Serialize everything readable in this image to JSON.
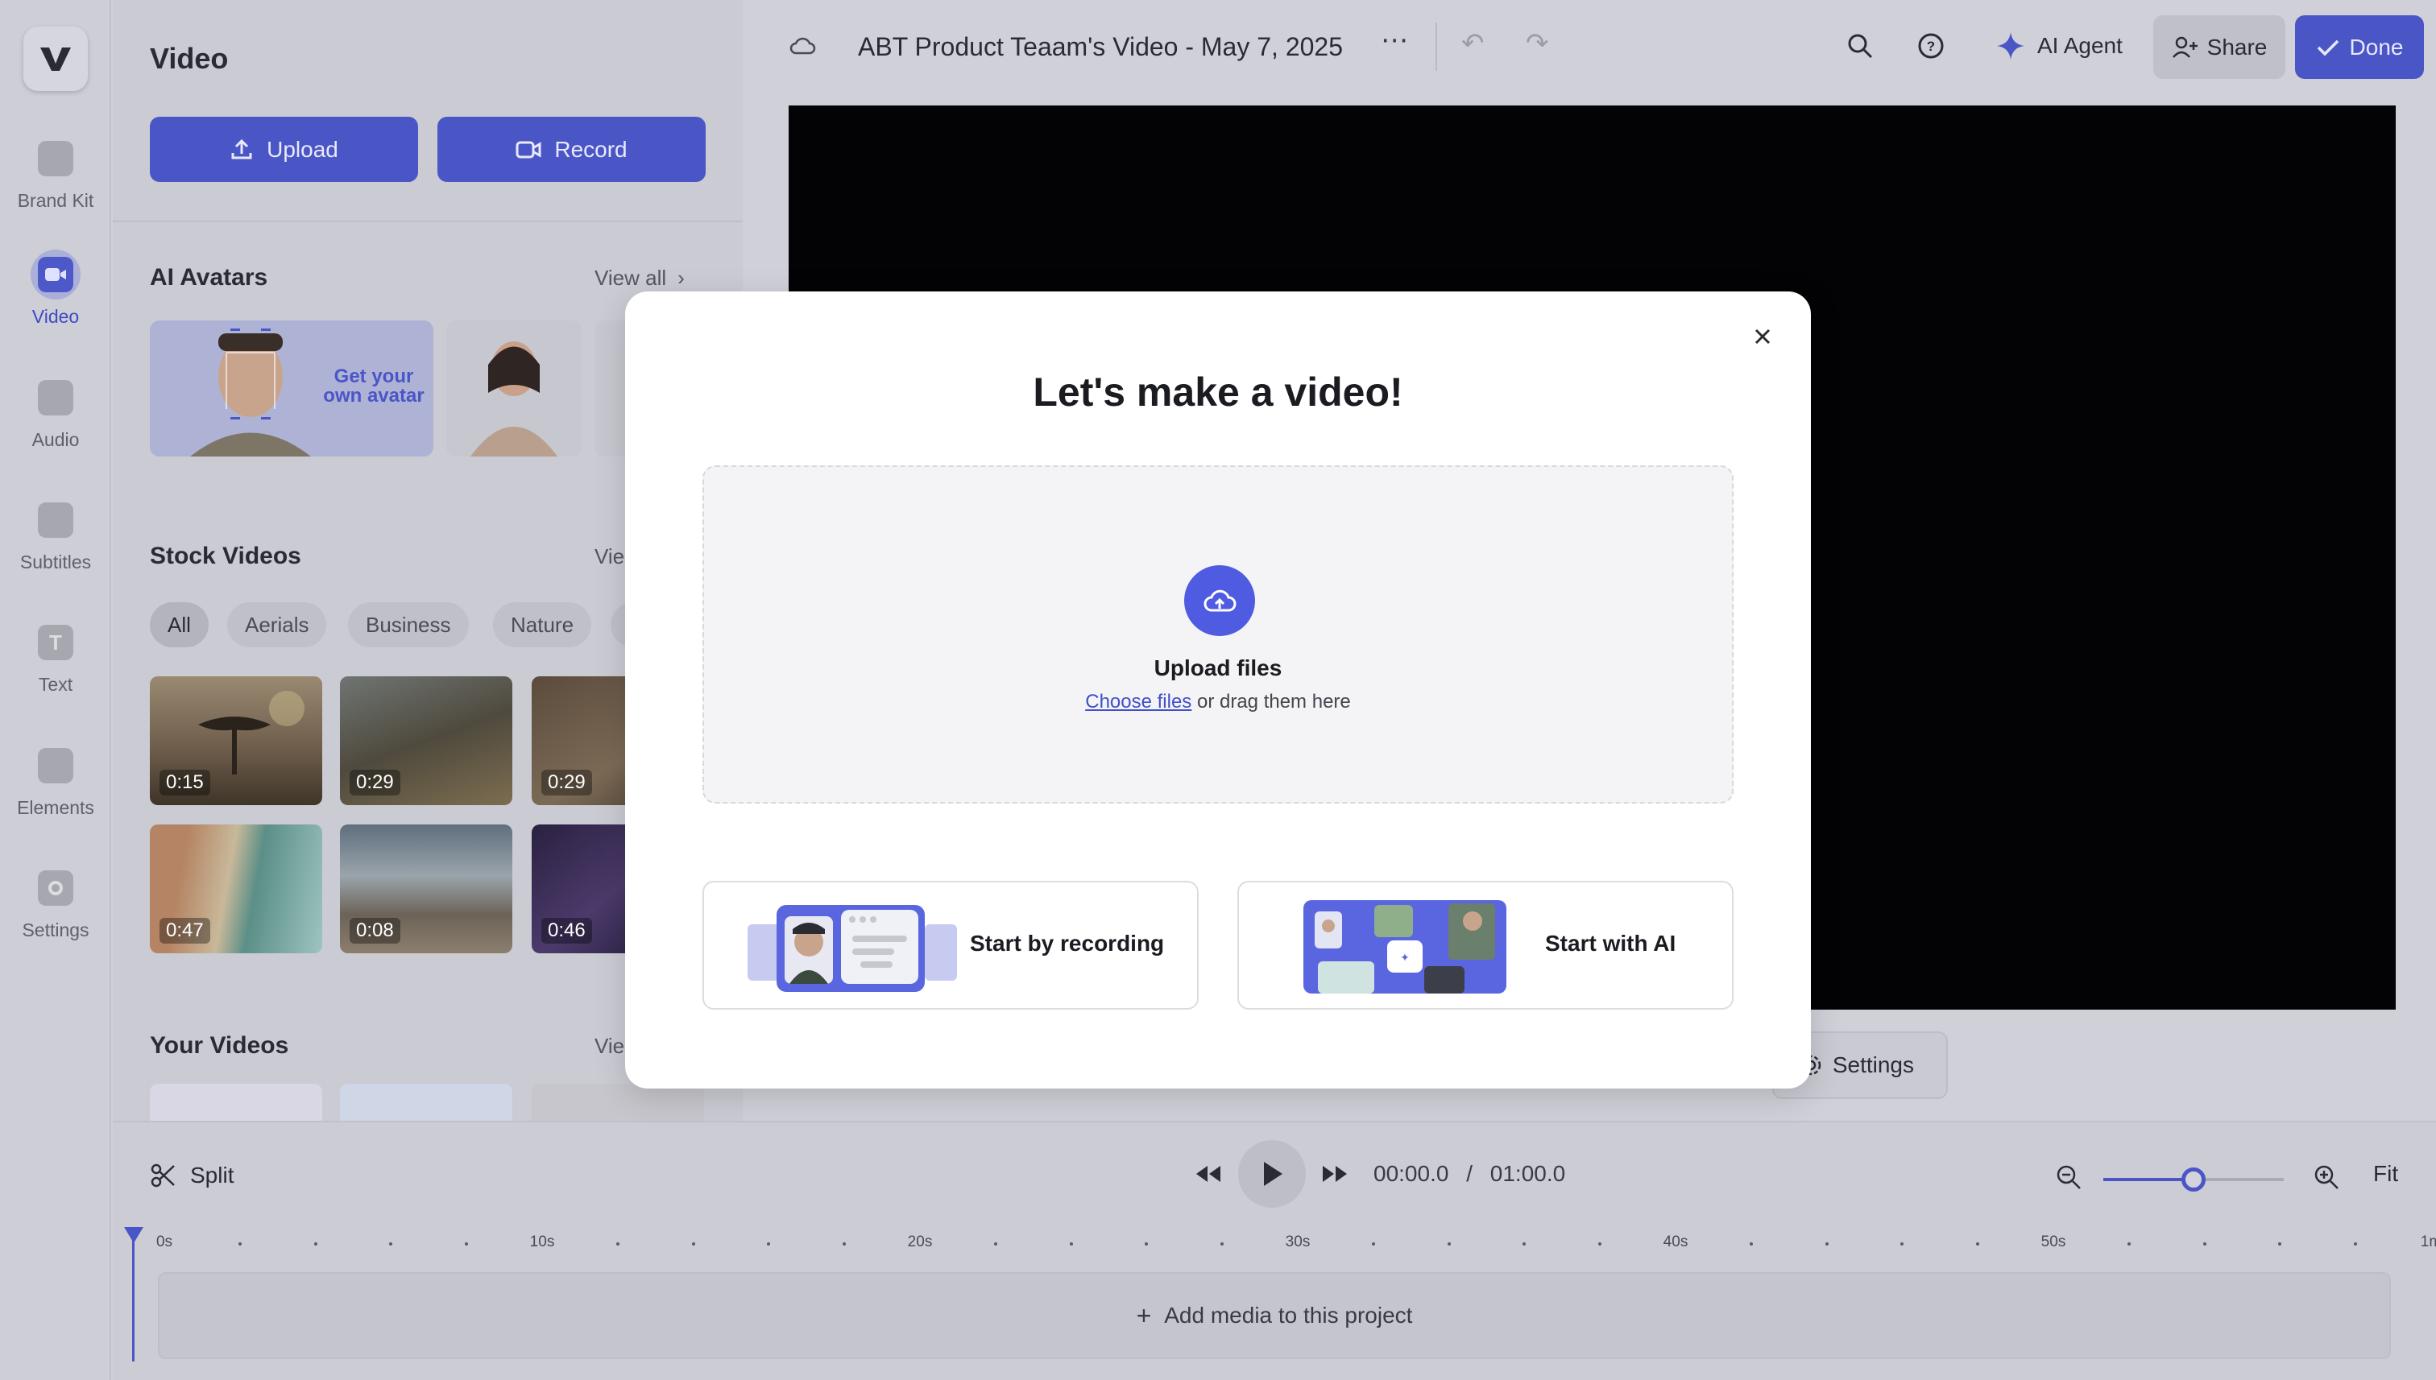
{
  "rail": {
    "logo": "V",
    "items": [
      {
        "label": "Brand Kit",
        "icon": "brand-kit-icon"
      },
      {
        "label": "Video",
        "icon": "video-icon",
        "active": true
      },
      {
        "label": "Audio",
        "icon": "music-note-icon"
      },
      {
        "label": "Subtitles",
        "icon": "subtitles-icon"
      },
      {
        "label": "Text",
        "icon": "text-icon"
      },
      {
        "label": "Elements",
        "icon": "elements-icon"
      },
      {
        "label": "Settings",
        "icon": "settings-icon"
      }
    ]
  },
  "panel": {
    "title": "Video",
    "upload_label": "Upload",
    "record_label": "Record",
    "avatars": {
      "title": "AI Avatars",
      "view_all": "View all",
      "cta": "Get your own avatar"
    },
    "stock": {
      "title": "Stock Videos",
      "view_all": "Vie",
      "chips": [
        "All",
        "Aerials",
        "Business",
        "Nature"
      ],
      "thumbs": [
        {
          "duration": "0:15"
        },
        {
          "duration": "0:29"
        },
        {
          "duration": "0:29"
        },
        {
          "duration": "0:47"
        },
        {
          "duration": "0:08"
        },
        {
          "duration": "0:46"
        }
      ]
    },
    "your_videos": {
      "title": "Your Videos",
      "view_all": "Vie"
    }
  },
  "topbar": {
    "project_title": "ABT Product Teaam's Video - May 7, 2025",
    "ai_agent_label": "AI Agent",
    "share_label": "Share",
    "done_label": "Done"
  },
  "preview": {
    "settings_label": "Settings"
  },
  "timeline": {
    "split_label": "Split",
    "current_time": "00:00.0",
    "separator": "/",
    "total_time": "01:00.0",
    "fit_label": "Fit",
    "zoom_level": 0.5,
    "ticks": [
      "0s",
      "10s",
      "20s",
      "30s",
      "40s",
      "50s",
      "1m"
    ],
    "add_media_label": "Add media to this project"
  },
  "modal": {
    "title": "Let's make a video!",
    "upload_title": "Upload files",
    "choose_files": "Choose files",
    "drag_text": "or drag them here",
    "option_recording": "Start by recording",
    "option_ai": "Start with AI"
  },
  "colors": {
    "accent": "#4b56c6",
    "modal_accent": "#4f5be0",
    "preview_bg": "#030306",
    "overlay_bg": "#cfd0d8"
  }
}
